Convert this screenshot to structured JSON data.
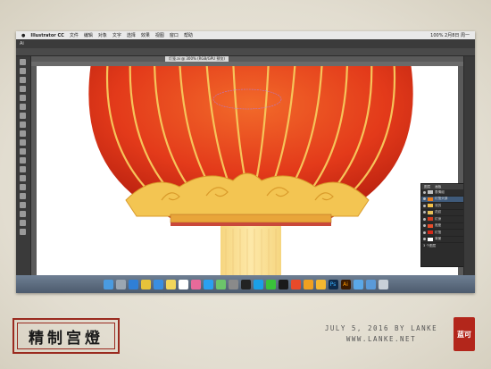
{
  "menubar": {
    "app": "Illustrator CC",
    "items": [
      "文件",
      "编辑",
      "对象",
      "文字",
      "选择",
      "效果",
      "视图",
      "窗口",
      "帮助"
    ],
    "status": "100%  2月8日 周一"
  },
  "document": {
    "tab": "灯笼.ai @ 300% (RGB/GPU 预览)"
  },
  "layers_panel": {
    "tabs": [
      "图层",
      "画板"
    ],
    "rows": [
      {
        "name": "表情组",
        "color": "#c0c0c0"
      },
      {
        "name": "灯笼头部",
        "color": "#e87a1c"
      },
      {
        "name": "流苏",
        "color": "#f2c04a"
      },
      {
        "name": "花纹",
        "color": "#e8c25a"
      },
      {
        "name": "灯身",
        "color": "#d23b1e"
      },
      {
        "name": "底座",
        "color": "#e84d2a"
      },
      {
        "name": "灯笼",
        "color": "#d42a1a"
      },
      {
        "name": "背景",
        "color": "#ffffff"
      }
    ],
    "footer": "3 个图层"
  },
  "dock_icons": [
    "finder-icon",
    "launchpad-icon",
    "safari-icon",
    "chrome-icon",
    "mail-icon",
    "notes-icon",
    "calendar-icon",
    "photos-icon",
    "appstore-icon",
    "maps-icon",
    "settings-icon",
    "music-icon",
    "qq-icon",
    "wechat-icon",
    "video-icon",
    "weibo-icon",
    "browser-icon",
    "sketch-icon",
    "photoshop-icon",
    "illustrator-icon",
    "folder-icon",
    "downloads-icon",
    "trash-icon"
  ],
  "artwork": {
    "lantern_body": "#e63a1c",
    "lantern_rib": "#f6c45a",
    "gold": "#e8b84a",
    "tassel": "#f4d48a"
  },
  "caption": {
    "title": "精制宫燈",
    "credit_line1": "JULY 5, 2016 BY LANKE",
    "credit_line2": "WWW.LANKE.NET",
    "stamp": "蓝可"
  }
}
